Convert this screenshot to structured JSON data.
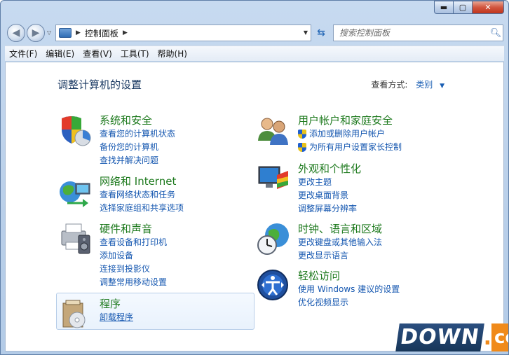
{
  "window": {
    "minimize_label": "▬",
    "maximize_label": "▢",
    "close_label": "✕"
  },
  "nav": {
    "back_glyph": "◀",
    "forward_glyph": "▶",
    "history_glyph": "▽"
  },
  "address": {
    "crumb": "控制面板",
    "icon": "control-panel-icon"
  },
  "search": {
    "placeholder": "搜索控制面板"
  },
  "menu": [
    "文件(F)",
    "编辑(E)",
    "查看(V)",
    "工具(T)",
    "帮助(H)"
  ],
  "page": {
    "title": "调整计算机的设置",
    "view_by_label": "查看方式:",
    "view_by_value": "类别"
  },
  "categories": {
    "system": {
      "title": "系统和安全",
      "icon": "shield-security-icon",
      "links": [
        "查看您的计算机状态",
        "备份您的计算机",
        "查找并解决问题"
      ]
    },
    "network": {
      "title": "网络和 Internet",
      "icon": "network-globe-icon",
      "links": [
        "查看网络状态和任务",
        "选择家庭组和共享选项"
      ]
    },
    "hardware": {
      "title": "硬件和声音",
      "icon": "printer-sound-icon",
      "links": [
        "查看设备和打印机",
        "添加设备",
        "连接到投影仪",
        "调整常用移动设置"
      ]
    },
    "programs": {
      "title": "程序",
      "icon": "programs-box-icon",
      "links": [
        "卸载程序"
      ]
    },
    "users": {
      "title": "用户帐户和家庭安全",
      "icon": "users-icon",
      "links": [
        "添加或删除用户帐户",
        "为所有用户设置家长控制"
      ]
    },
    "appearance": {
      "title": "外观和个性化",
      "icon": "monitor-palette-icon",
      "links": [
        "更改主题",
        "更改桌面背景",
        "调整屏幕分辨率"
      ]
    },
    "clock": {
      "title": "时钟、语言和区域",
      "icon": "clock-globe-icon",
      "links": [
        "更改键盘或其他输入法",
        "更改显示语言"
      ]
    },
    "ease": {
      "title": "轻松访问",
      "icon": "ease-of-access-icon",
      "links": [
        "使用 Windows 建议的设置",
        "优化视频显示"
      ]
    }
  },
  "watermark": {
    "main": "DOWN",
    "dot": ".",
    "suffix": "cc"
  },
  "colors": {
    "category_title": "#1e7a1e",
    "link": "#1557b0",
    "frame": "#b9cfe9"
  }
}
